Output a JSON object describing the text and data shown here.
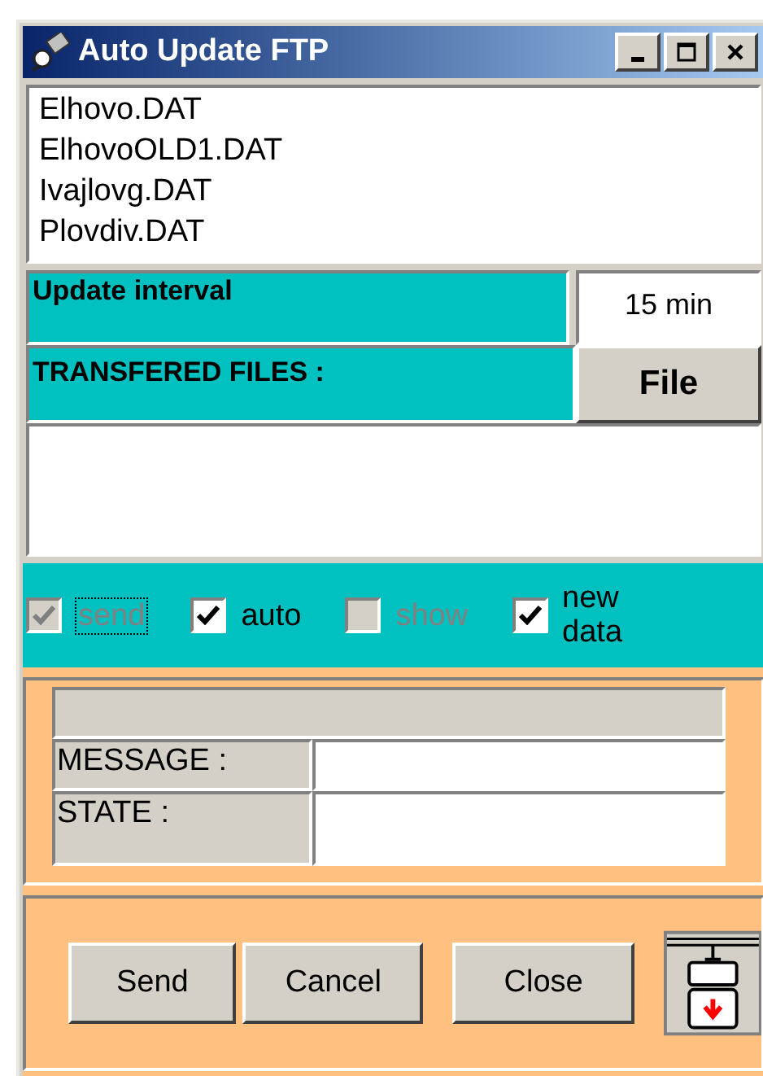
{
  "window": {
    "title": "Auto Update FTP"
  },
  "title_buttons": [
    {
      "kind": "minimize"
    },
    {
      "kind": "maximize"
    },
    {
      "kind": "close"
    }
  ],
  "files": [
    "Elhovo.DAT",
    "ElhovoOLD1.DAT",
    "Ivajlovg.DAT",
    "Plovdiv.DAT"
  ],
  "update_interval": {
    "label": "Update interval",
    "value": "15 min"
  },
  "transferred": {
    "label": "TRANSFERED FILES :",
    "button": "File"
  },
  "options": [
    {
      "label": "send",
      "checked": true,
      "disabled": true,
      "focused": true
    },
    {
      "label": "auto",
      "checked": true,
      "disabled": false,
      "focused": false
    },
    {
      "label": "show",
      "checked": false,
      "disabled": true,
      "focused": false
    },
    {
      "label": "new data",
      "checked": true,
      "disabled": false,
      "focused": false
    }
  ],
  "status": [
    {
      "label": "MESSAGE :"
    },
    {
      "label": "STATE :"
    }
  ],
  "buttons": [
    "Send",
    "Cancel",
    "Close"
  ]
}
